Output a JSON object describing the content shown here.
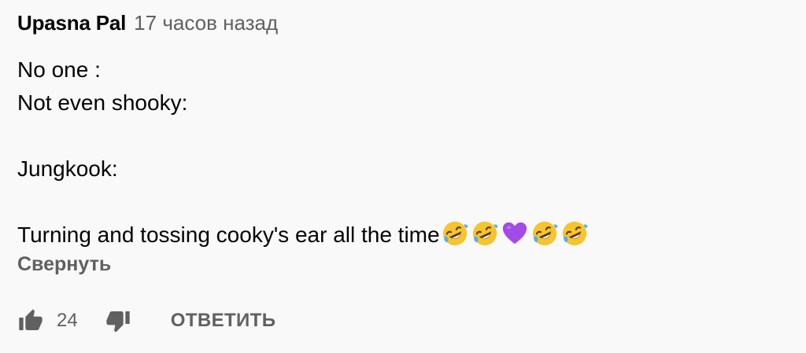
{
  "comment": {
    "author": "Upasna Pal",
    "timestamp": "17 часов назад",
    "lines": [
      "No one :",
      "Not even shooky:",
      "",
      "Jungkook:",
      "",
      "Turning and tossing cooky's ear all the time"
    ],
    "emojis": [
      "rolling-on-floor-laughing-emoji",
      "rolling-on-floor-laughing-emoji",
      "purple-heart-emoji",
      "rolling-on-floor-laughing-emoji",
      "rolling-on-floor-laughing-emoji"
    ],
    "collapse_label": "Свернуть"
  },
  "actions": {
    "like_count": "24",
    "reply_label": "ОТВЕТИТЬ"
  },
  "colors": {
    "background": "#f9f9f9",
    "text": "#030303",
    "secondary": "#606060",
    "emoji_yellow": "#f7c42f",
    "heart_purple": "#a24be6"
  }
}
